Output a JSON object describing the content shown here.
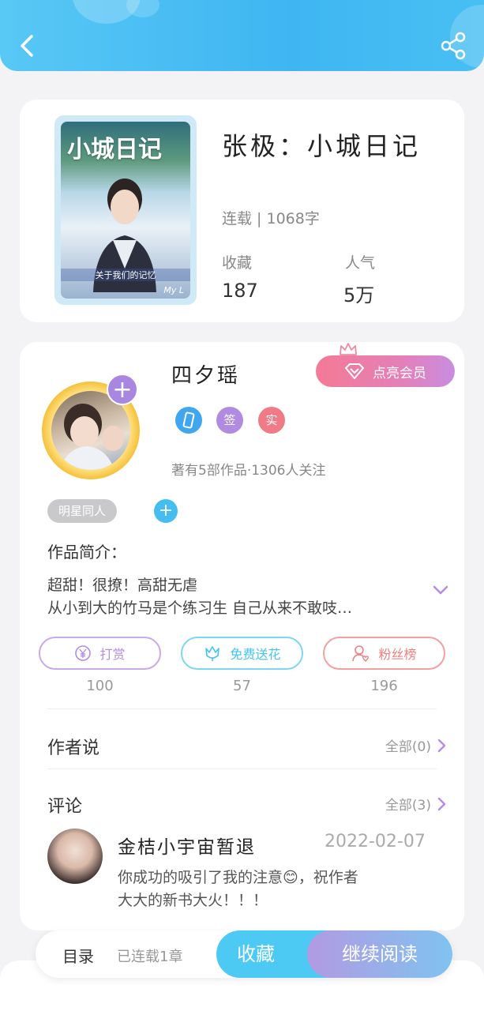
{
  "header": {
    "back_icon": "chevron-left-icon",
    "share_icon": "share-icon"
  },
  "book": {
    "title": "张极：小城日记",
    "status_line": "连载 | 1068字",
    "stats": [
      {
        "label": "收藏",
        "value": "187"
      },
      {
        "label": "人气",
        "value": "5万"
      }
    ],
    "cover": {
      "title": "小城日记",
      "caption": "关于我们的记忆",
      "mark": "My L"
    }
  },
  "author": {
    "name": "四夕瑶",
    "vip_button": "点亮会员",
    "badges": [
      {
        "text": "",
        "icon": "phone-icon",
        "color": "#3fa6ef"
      },
      {
        "text": "签",
        "color": "#b08be0"
      },
      {
        "text": "实",
        "color": "#f07a86"
      }
    ],
    "works_info": "著有5部作品·1306人关注",
    "tag": "明星同人"
  },
  "intro": {
    "title": "作品简介：",
    "lines": [
      "超甜！很撩！高甜无虐",
      "从小到大的竹马是个练习生 自己从来不敢吱…"
    ]
  },
  "actions": [
    {
      "label": "打赏",
      "count": "100",
      "icon": "yen-icon",
      "color": "#b48be6"
    },
    {
      "label": "免费送花",
      "count": "57",
      "icon": "flower-icon",
      "color": "#45c3ef"
    },
    {
      "label": "粉丝榜",
      "count": "196",
      "icon": "fan-rank-icon",
      "color": "#f08080"
    }
  ],
  "author_says": {
    "title": "作者说",
    "link": "全部(0)"
  },
  "comments": {
    "title": "评论",
    "link": "全部(3)",
    "items": [
      {
        "user": "金桔小宇宙暂退",
        "date": "2022-02-07",
        "lines": [
          "你成功的吸引了我的注意😊，祝作者",
          "大大的新书大火！！！"
        ]
      }
    ]
  },
  "bottom_bar": {
    "toc": "目录",
    "toc_sub": "已连载1章",
    "favorite": "收藏",
    "read": "继续阅读"
  }
}
